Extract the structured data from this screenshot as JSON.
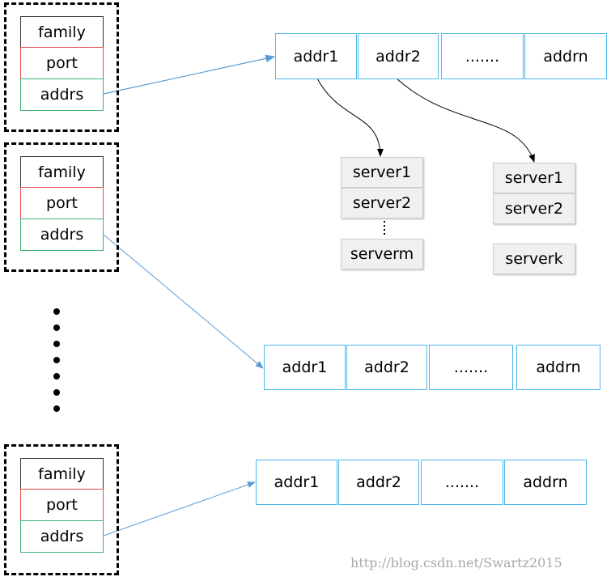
{
  "groups": [
    {
      "family": "family",
      "port": "port",
      "addrs": "addrs"
    },
    {
      "family": "family",
      "port": "port",
      "addrs": "addrs"
    },
    {
      "family": "family",
      "port": "port",
      "addrs": "addrs"
    }
  ],
  "arrays": [
    [
      "addr1",
      "addr2",
      ".......",
      "addrn"
    ],
    [
      "addr1",
      "addr2",
      ".......",
      "addrn"
    ],
    [
      "addr1",
      "addr2",
      ".......",
      "addrn"
    ]
  ],
  "servers_left": [
    "server1",
    "server2",
    "serverm"
  ],
  "servers_right": [
    "server1",
    "server2",
    "serverk"
  ],
  "watermark": "http://blog.csdn.net/Swartz2015",
  "colors": {
    "family_border": "#333333",
    "port_border": "#e84a4a",
    "addrs_border": "#3cb371",
    "array_border": "#4fb8ec",
    "arrow_blue": "#5b9bd5",
    "server_fill": "#f0f0f0"
  }
}
